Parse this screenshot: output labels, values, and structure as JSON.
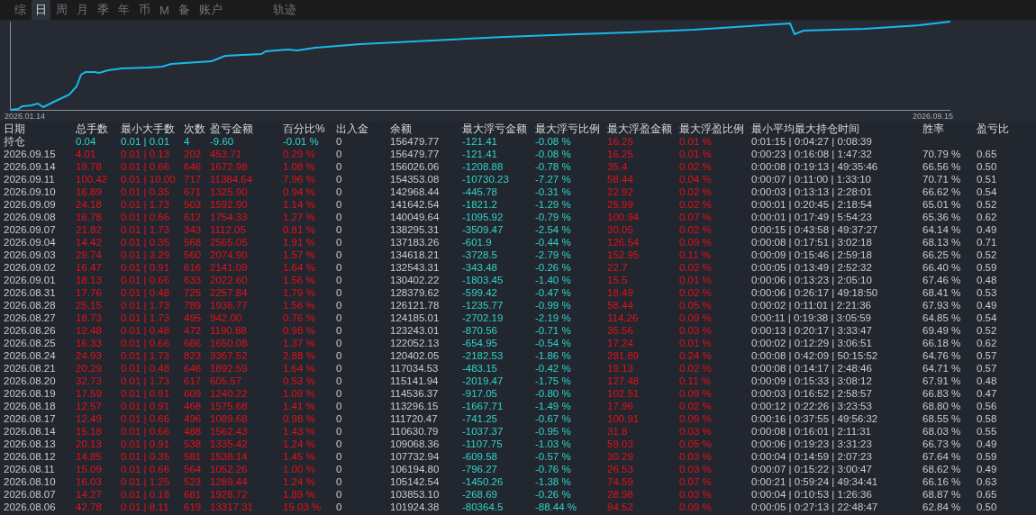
{
  "tabs": [
    {
      "label": "综",
      "selected": false
    },
    {
      "label": "日",
      "selected": true
    },
    {
      "label": "周",
      "selected": false
    },
    {
      "label": "月",
      "selected": false
    },
    {
      "label": "季",
      "selected": false
    },
    {
      "label": "年",
      "selected": false
    },
    {
      "label": "币",
      "selected": false
    },
    {
      "label": "M",
      "selected": false
    },
    {
      "label": "备",
      "selected": false
    },
    {
      "label": "账户",
      "selected": false
    },
    {
      "label": "轨迹",
      "selected": false
    }
  ],
  "chart": {
    "start_label": "2026.01.14",
    "end_label": "2026.09.15"
  },
  "table": {
    "columns": [
      "日期",
      "总手数",
      "最小大手数",
      "次数",
      "盈亏金额",
      "百分比%",
      "出入金",
      "余额",
      "最大浮亏金额",
      "最大浮亏比例",
      "最大浮盈金额",
      "最大浮盈比例",
      "最小平均最大持仓时间",
      "胜率",
      "盈亏比"
    ],
    "rows": [
      {
        "kind": "position",
        "cells": [
          "持仓",
          "0.04",
          "0.01 | 0.01",
          "4",
          "-9.60",
          "-0.01 %",
          "0",
          "156479.77",
          "-121.41",
          "-0.08 %",
          "16.25",
          "0.01 %",
          "0:01:15 | 0:04:27 | 0:08:39",
          "",
          ""
        ]
      },
      {
        "kind": "day",
        "cells": [
          "2026.09.15",
          "4.01",
          "0.01 | 0.13",
          "202",
          "453.71",
          "0.29 %",
          "0",
          "156479.77",
          "-121.41",
          "-0.08 %",
          "16.25",
          "0.01 %",
          "0:00:23 | 0:16:08 | 1:47:32",
          "70.79 %",
          "0.65"
        ]
      },
      {
        "kind": "day",
        "cells": [
          "2026.09.14",
          "19.78",
          "0.01 | 0.66",
          "646",
          "1672.98",
          "1.08 %",
          "0",
          "156026.06",
          "-1208.88",
          "-0.78 %",
          "35.4",
          "0.02 %",
          "0:00:08 | 0:19:13 | 49:35:46",
          "66.56 %",
          "0.50"
        ]
      },
      {
        "kind": "day",
        "cells": [
          "2026.09.11",
          "100.42",
          "0.01 | 10.00",
          "717",
          "11384.64",
          "7.96 %",
          "0",
          "154353.08",
          "-10730.23",
          "-7.27 %",
          "58.44",
          "0.04 %",
          "0:00:07 | 0:11:00 | 1:33:10",
          "70.71 %",
          "0.51"
        ]
      },
      {
        "kind": "day",
        "cells": [
          "2026.09.10",
          "16.89",
          "0.01 | 0.35",
          "671",
          "1325.90",
          "0.94 %",
          "0",
          "142968.44",
          "-445.78",
          "-0.31 %",
          "22.92",
          "0.02 %",
          "0:00:03 | 0:13:13 | 2:28:01",
          "66.62 %",
          "0.54"
        ]
      },
      {
        "kind": "day",
        "cells": [
          "2026.09.09",
          "24.18",
          "0.01 | 1.73",
          "503",
          "1592.90",
          "1.14 %",
          "0",
          "141642.54",
          "-1821.2",
          "-1.29 %",
          "25.99",
          "0.02 %",
          "0:00:01 | 0:20:45 | 2:18:54",
          "65.01 %",
          "0.52"
        ]
      },
      {
        "kind": "day",
        "cells": [
          "2026.09.08",
          "16.78",
          "0.01 | 0.66",
          "612",
          "1754.33",
          "1.27 %",
          "0",
          "140049.64",
          "-1095.92",
          "-0.79 %",
          "100.94",
          "0.07 %",
          "0:00:01 | 0:17:49 | 5:54:23",
          "65.36 %",
          "0.62"
        ]
      },
      {
        "kind": "day",
        "cells": [
          "2026.09.07",
          "21.82",
          "0.01 | 1.73",
          "343",
          "1112.05",
          "0.81 %",
          "0",
          "138295.31",
          "-3509.47",
          "-2.54 %",
          "30.05",
          "0.02 %",
          "0:00:15 | 0:43:58 | 49:37:27",
          "64.14 %",
          "0.49"
        ]
      },
      {
        "kind": "day",
        "cells": [
          "2026.09.04",
          "14.42",
          "0.01 | 0.35",
          "568",
          "2565.05",
          "1.91 %",
          "0",
          "137183.26",
          "-601.9",
          "-0.44 %",
          "126.54",
          "0.09 %",
          "0:00:08 | 0:17:51 | 3:02:18",
          "68.13 %",
          "0.71"
        ]
      },
      {
        "kind": "day",
        "cells": [
          "2026.09.03",
          "29.74",
          "0.01 | 3.29",
          "560",
          "2074.90",
          "1.57 %",
          "0",
          "134618.21",
          "-3728.5",
          "-2.79 %",
          "152.95",
          "0.11 %",
          "0:00:09 | 0:15:46 | 2:59:18",
          "66.25 %",
          "0.52"
        ]
      },
      {
        "kind": "day",
        "cells": [
          "2026.09.02",
          "16.47",
          "0.01 | 0.91",
          "616",
          "2141.09",
          "1.64 %",
          "0",
          "132543.31",
          "-343.48",
          "-0.26 %",
          "22.7",
          "0.02 %",
          "0:00:05 | 0:13:49 | 2:52:32",
          "66.40 %",
          "0.59"
        ]
      },
      {
        "kind": "day",
        "cells": [
          "2026.09.01",
          "18.13",
          "0.01 | 0.66",
          "633",
          "2022.60",
          "1.56 %",
          "0",
          "130402.22",
          "-1803.45",
          "-1.40 %",
          "15.5",
          "0.01 %",
          "0:00:06 | 0:13:23 | 2:05:10",
          "67.46 %",
          "0.48"
        ]
      },
      {
        "kind": "day",
        "cells": [
          "2026.08.31",
          "17.76",
          "0.01 | 0.48",
          "725",
          "2257.84",
          "1.79 %",
          "0",
          "128379.62",
          "-599.42",
          "-0.47 %",
          "18.49",
          "0.02 %",
          "0:00:06 | 0:26:17 | 49:18:50",
          "68.41 %",
          "0.53"
        ]
      },
      {
        "kind": "day",
        "cells": [
          "2026.08.28",
          "25.15",
          "0.01 | 1.73",
          "789",
          "1936.77",
          "1.56 %",
          "0",
          "126121.78",
          "-1235.77",
          "-0.99 %",
          "58.44",
          "0.05 %",
          "0:00:02 | 0:11:01 | 2:21:36",
          "67.93 %",
          "0.49"
        ]
      },
      {
        "kind": "day",
        "cells": [
          "2026.08.27",
          "18.73",
          "0.01 | 1.73",
          "495",
          "942.00",
          "0.76 %",
          "0",
          "124185.01",
          "-2702.19",
          "-2.19 %",
          "114.26",
          "0.09 %",
          "0:00:11 | 0:19:38 | 3:05:59",
          "64.85 %",
          "0.54"
        ]
      },
      {
        "kind": "day",
        "cells": [
          "2026.08.26",
          "12.48",
          "0.01 | 0.48",
          "472",
          "1190.88",
          "0.98 %",
          "0",
          "123243.01",
          "-870.56",
          "-0.71 %",
          "35.56",
          "0.03 %",
          "0:00:13 | 0:20:17 | 3:33:47",
          "69.49 %",
          "0.52"
        ]
      },
      {
        "kind": "day",
        "cells": [
          "2026.08.25",
          "16.33",
          "0.01 | 0.66",
          "686",
          "1650.08",
          "1.37 %",
          "0",
          "122052.13",
          "-654.95",
          "-0.54 %",
          "17.24",
          "0.01 %",
          "0:00:02 | 0:12:29 | 3:06:51",
          "66.18 %",
          "0.62"
        ]
      },
      {
        "kind": "day",
        "cells": [
          "2026.08.24",
          "24.93",
          "0.01 | 1.73",
          "823",
          "3367.52",
          "2.88 %",
          "0",
          "120402.05",
          "-2182.53",
          "-1.86 %",
          "281.89",
          "0.24 %",
          "0:00:08 | 0:42:09 | 50:15:52",
          "64.76 %",
          "0.57"
        ]
      },
      {
        "kind": "day",
        "cells": [
          "2026.08.21",
          "20.29",
          "0.01 | 0.48",
          "646",
          "1892.59",
          "1.64 %",
          "0",
          "117034.53",
          "-483.15",
          "-0.42 %",
          "19.13",
          "0.02 %",
          "0:00:08 | 0:14:17 | 2:48:46",
          "64.71 %",
          "0.57"
        ]
      },
      {
        "kind": "day",
        "cells": [
          "2026.08.20",
          "32.73",
          "0.01 | 1.73",
          "617",
          "605.57",
          "0.53 %",
          "0",
          "115141.94",
          "-2019.47",
          "-1.75 %",
          "127.48",
          "0.11 %",
          "0:00:09 | 0:15:33 | 3:08:12",
          "67.91 %",
          "0.48"
        ]
      },
      {
        "kind": "day",
        "cells": [
          "2026.08.19",
          "17.59",
          "0.01 | 0.91",
          "609",
          "1240.22",
          "1.09 %",
          "0",
          "114536.37",
          "-917.05",
          "-0.80 %",
          "102.51",
          "0.09 %",
          "0:00:03 | 0:16:52 | 2:58:57",
          "66.83 %",
          "0.47"
        ]
      },
      {
        "kind": "day",
        "cells": [
          "2026.08.18",
          "12.57",
          "0.01 | 0.91",
          "468",
          "1575.68",
          "1.41 %",
          "0",
          "113296.15",
          "-1667.71",
          "-1.49 %",
          "17.96",
          "0.02 %",
          "0:00:12 | 0:22:26 | 3:23:53",
          "68.80 %",
          "0.56"
        ]
      },
      {
        "kind": "day",
        "cells": [
          "2026.08.17",
          "12.49",
          "0.01 | 0.66",
          "496",
          "1089.68",
          "0.98 %",
          "0",
          "111720.47",
          "-741.25",
          "-0.67 %",
          "100.91",
          "0.09 %",
          "0:00:16 | 0:37:55 | 49:56:32",
          "68.55 %",
          "0.58"
        ]
      },
      {
        "kind": "day",
        "cells": [
          "2026.08.14",
          "15.18",
          "0.01 | 0.66",
          "488",
          "1562.43",
          "1.43 %",
          "0",
          "110630.79",
          "-1037.37",
          "-0.95 %",
          "31.8",
          "0.03 %",
          "0:00:08 | 0:16:01 | 2:11:31",
          "68.03 %",
          "0.55"
        ]
      },
      {
        "kind": "day",
        "cells": [
          "2026.08.13",
          "20.13",
          "0.01 | 0.91",
          "538",
          "1335.42",
          "1.24 %",
          "0",
          "109068.36",
          "-1107.75",
          "-1.03 %",
          "59.03",
          "0.05 %",
          "0:00:06 | 0:19:23 | 3:31:23",
          "66.73 %",
          "0.49"
        ]
      },
      {
        "kind": "day",
        "cells": [
          "2026.08.12",
          "14.85",
          "0.01 | 0.35",
          "581",
          "1538.14",
          "1.45 %",
          "0",
          "107732.94",
          "-609.58",
          "-0.57 %",
          "30.29",
          "0.03 %",
          "0:00:04 | 0:14:59 | 2:07:23",
          "67.64 %",
          "0.59"
        ]
      },
      {
        "kind": "day",
        "cells": [
          "2026.08.11",
          "15.09",
          "0.01 | 0.66",
          "564",
          "1052.26",
          "1.00 %",
          "0",
          "106194.80",
          "-796.27",
          "-0.76 %",
          "26.53",
          "0.03 %",
          "0:00:07 | 0:15:22 | 3:00:47",
          "68.62 %",
          "0.49"
        ]
      },
      {
        "kind": "day",
        "cells": [
          "2026.08.10",
          "16.03",
          "0.01 | 1.25",
          "523",
          "1289.44",
          "1.24 %",
          "0",
          "105142.54",
          "-1450.26",
          "-1.38 %",
          "74.59",
          "0.07 %",
          "0:00:21 | 0:59:24 | 49:34:41",
          "66.16 %",
          "0.63"
        ]
      },
      {
        "kind": "day",
        "cells": [
          "2026.08.07",
          "14.27",
          "0.01 | 0.18",
          "681",
          "1928.72",
          "1.89 %",
          "0",
          "103853.10",
          "-268.69",
          "-0.26 %",
          "28.98",
          "0.03 %",
          "0:00:04 | 0:10:53 | 1:26:36",
          "68.87 %",
          "0.65"
        ]
      },
      {
        "kind": "day",
        "cells": [
          "2026.08.06",
          "42.78",
          "0.01 | 8.11",
          "619",
          "13317.31",
          "15.03 %",
          "0",
          "101924.38",
          "-80364.5",
          "-88.44 %",
          "94.52",
          "0.09 %",
          "0:00:05 | 0:27:13 | 22:48:47",
          "62.84 %",
          "0.50"
        ]
      }
    ]
  }
}
